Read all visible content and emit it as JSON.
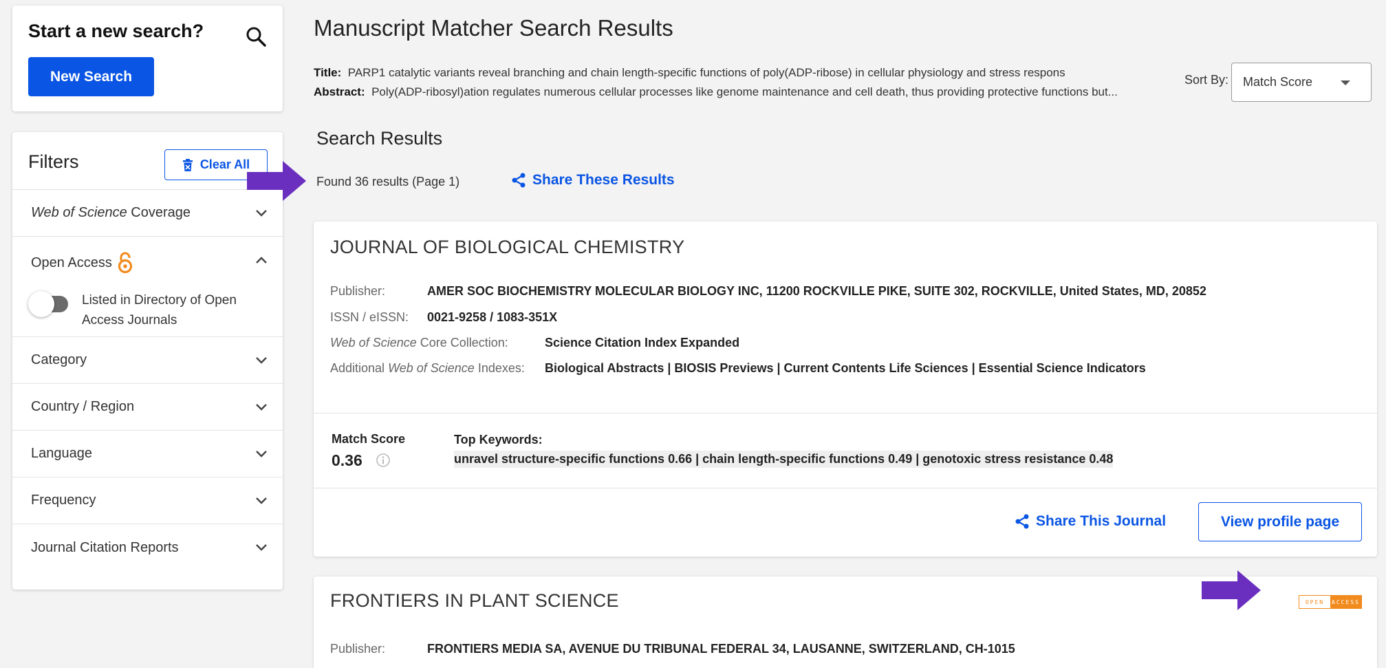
{
  "sidebar": {
    "new_search_title": "Start a new search?",
    "new_search_button": "New Search",
    "filters_title": "Filters",
    "clear_all": "Clear All",
    "filter_items": {
      "wos_coverage_italic": "Web of Science",
      "wos_coverage_rest": " Coverage",
      "open_access": "Open Access",
      "open_access_toggle_label": "Listed in Directory of Open Access Journals",
      "category": "Category",
      "country": "Country / Region",
      "language": "Language",
      "frequency": "Frequency",
      "jcr": "Journal Citation Reports"
    }
  },
  "main": {
    "page_title": "Manuscript Matcher Search Results",
    "title_label": "Title:",
    "title_value": "PARP1 catalytic variants reveal branching and chain length-specific functions of poly(ADP-ribose) in cellular physiology and stress respons",
    "abstract_label": "Abstract:",
    "abstract_value": "Poly(ADP-ribosyl)ation regulates numerous cellular processes like genome maintenance and cell death, thus providing protective functions but...",
    "sort_label": "Sort By:",
    "sort_value": "Match Score",
    "results_heading": "Search Results",
    "found_text": "Found 36 results (Page 1)",
    "share_results": "Share These Results"
  },
  "journals": [
    {
      "name": "JOURNAL OF BIOLOGICAL CHEMISTRY",
      "publisher_label": "Publisher:",
      "publisher": "AMER SOC BIOCHEMISTRY MOLECULAR BIOLOGY INC, 11200 ROCKVILLE PIKE, SUITE 302, ROCKVILLE, United States, MD, 20852",
      "issn_label": "ISSN / eISSN:",
      "issn": "0021-9258 / 1083-351X",
      "core_label_italic": "Web of Science",
      "core_label_rest": " Core Collection:",
      "core": "Science Citation Index Expanded",
      "additional_label_pre": "Additional ",
      "additional_label_italic": "Web of Science",
      "additional_label_post": " Indexes:",
      "additional": "Biological Abstracts | BIOSIS Previews | Current Contents Life Sciences | Essential Science Indicators",
      "match_score_label": "Match Score",
      "match_score": "0.36",
      "keywords_label": "Top Keywords:",
      "keywords": "unravel structure-specific functions 0.66 |  chain length-specific functions 0.49 |  genotoxic stress resistance 0.48",
      "share_journal": "Share This Journal",
      "view_profile": "View profile page"
    },
    {
      "name": "FRONTIERS IN PLANT SCIENCE",
      "publisher_label": "Publisher:",
      "publisher": "FRONTIERS MEDIA SA, AVENUE DU TRIBUNAL FEDERAL 34, LAUSANNE, SWITZERLAND, CH-1015",
      "oa_badge_left": "OPEN",
      "oa_badge_right": "ACCESS"
    }
  ],
  "colors": {
    "accent": "#0a55e3",
    "open_access_orange": "#f28b1d",
    "annotation_arrow": "#6a2fbf"
  }
}
